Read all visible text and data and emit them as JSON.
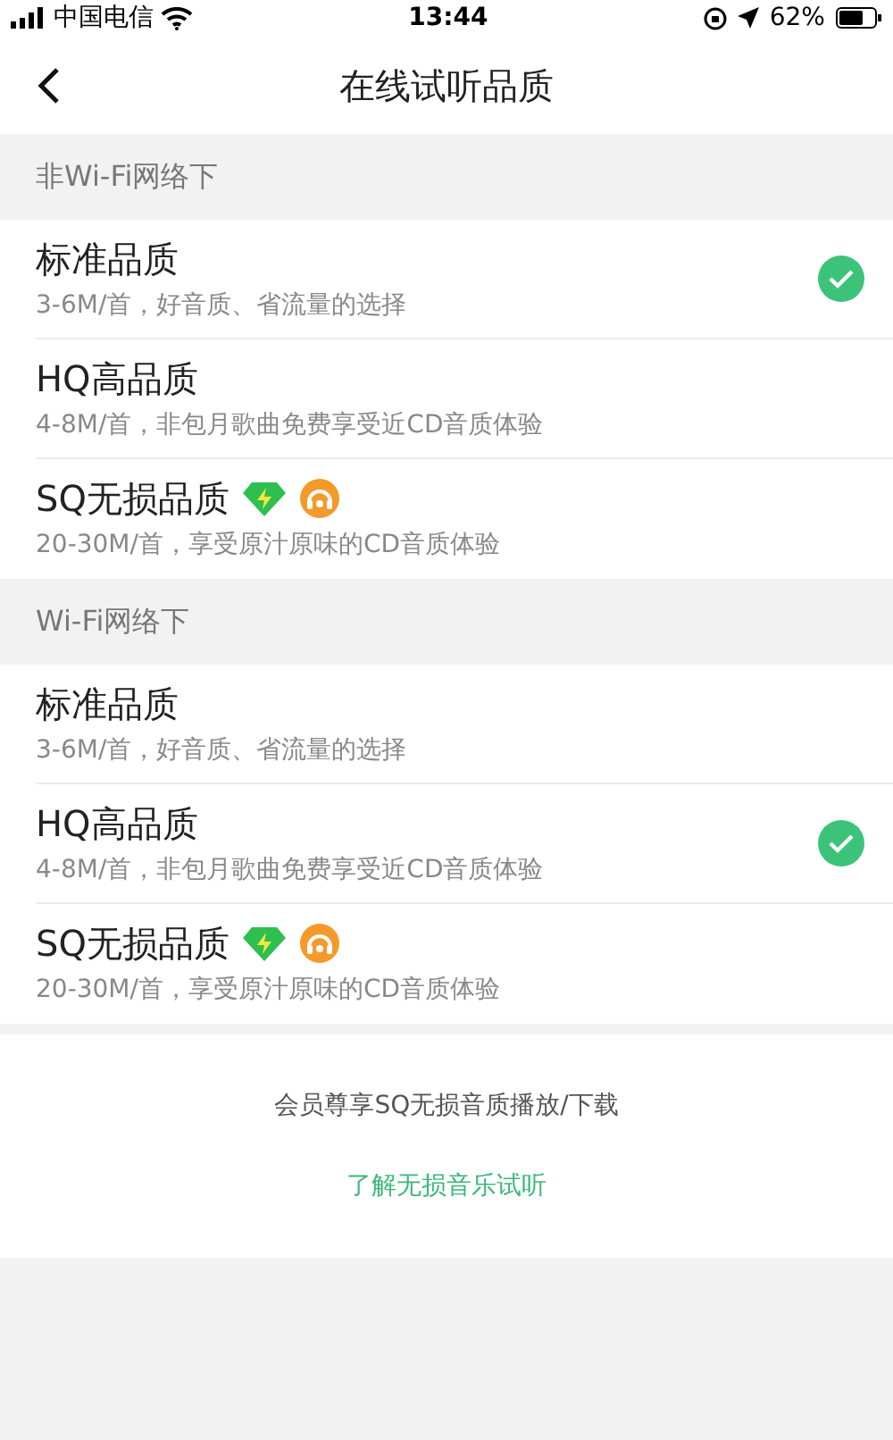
{
  "status_bar": {
    "carrier": "中国电信",
    "time": "13:44",
    "battery": "62%"
  },
  "nav": {
    "title": "在线试听品质"
  },
  "sections": [
    {
      "header": "非Wi-Fi网络下",
      "options": [
        {
          "title": "标准品质",
          "description": "3-6M/首，好音质、省流量的选择",
          "selected": true
        },
        {
          "title": "HQ高品质",
          "description": "4-8M/首，非包月歌曲免费享受近CD音质体验",
          "selected": false
        },
        {
          "title": "SQ无损品质",
          "description": "20-30M/首，享受原汁原味的CD音质体验",
          "selected": false,
          "badges": [
            {
              "kind": "diamond"
            },
            {
              "kind": "headphone"
            }
          ]
        }
      ]
    },
    {
      "header": "Wi-Fi网络下",
      "options": [
        {
          "title": "标准品质",
          "description": "3-6M/首，好音质、省流量的选择",
          "selected": false
        },
        {
          "title": "HQ高品质",
          "description": "4-8M/首，非包月歌曲免费享受近CD音质体验",
          "selected": true
        },
        {
          "title": "SQ无损品质",
          "description": "20-30M/首，享受原汁原味的CD音质体验",
          "selected": false,
          "badges": [
            {
              "kind": "diamond"
            },
            {
              "kind": "headphone"
            }
          ]
        }
      ]
    }
  ],
  "footer": {
    "note": "会员尊享SQ无损音质播放/下载",
    "link": "了解无损音乐试听"
  }
}
